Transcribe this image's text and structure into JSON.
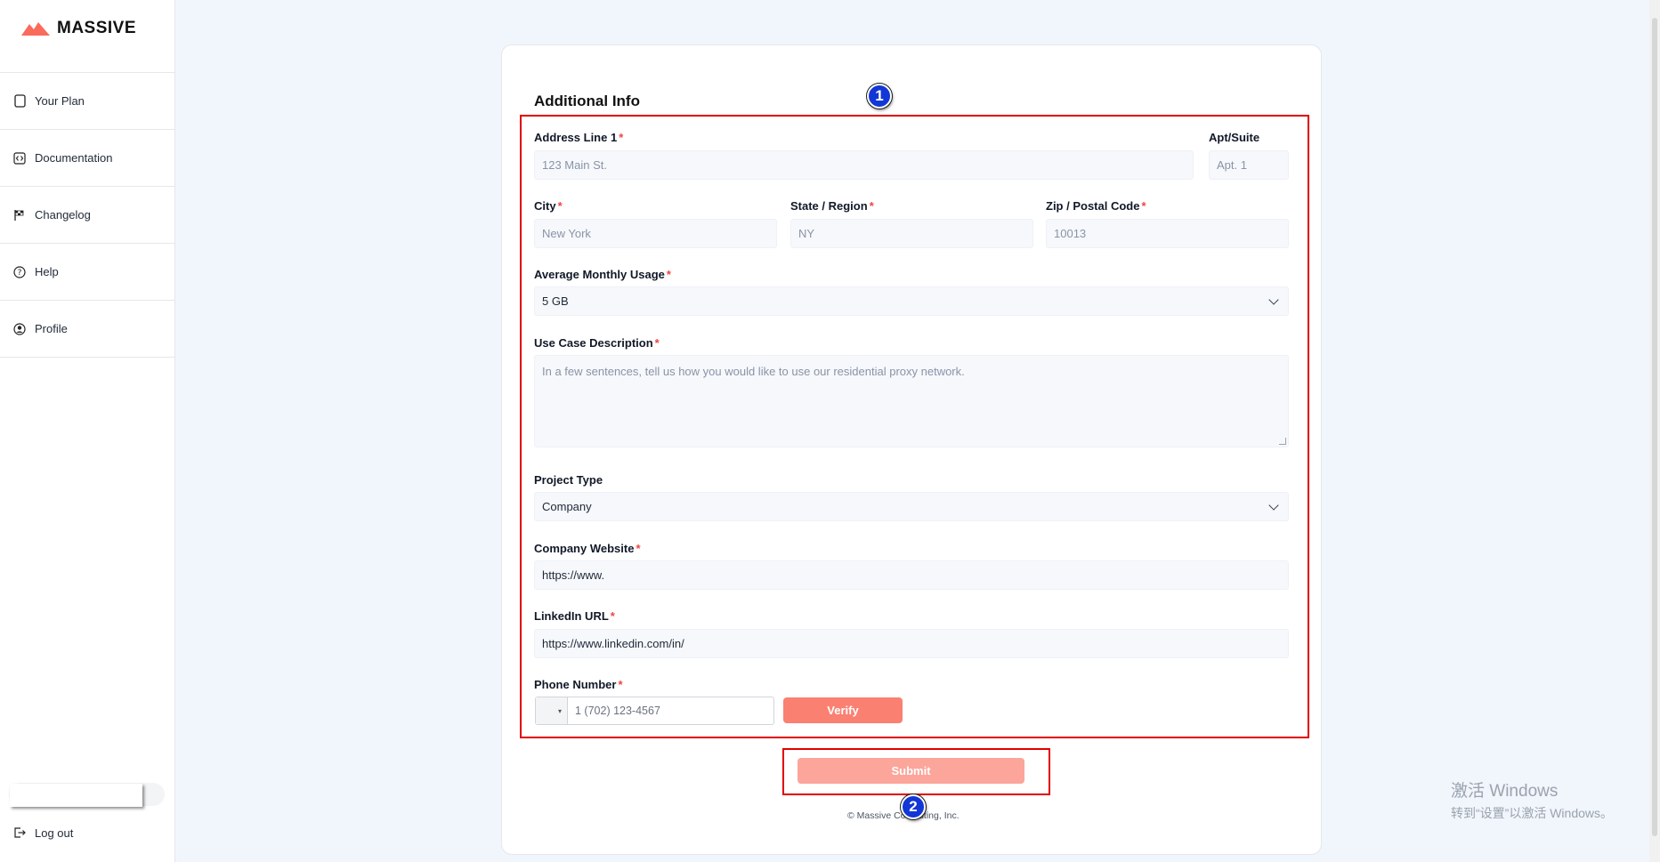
{
  "brand": {
    "name": "MASSIVE",
    "color": "#fa6b5c"
  },
  "sidebar": {
    "items": [
      {
        "label": "Your Plan",
        "icon": "document-icon"
      },
      {
        "label": "Documentation",
        "icon": "code-icon"
      },
      {
        "label": "Changelog",
        "icon": "flag-icon"
      },
      {
        "label": "Help",
        "icon": "help-icon"
      },
      {
        "label": "Profile",
        "icon": "user-circle-icon"
      }
    ],
    "logout": {
      "label": "Log out",
      "icon": "logout-icon"
    }
  },
  "form": {
    "title": "Additional Info",
    "address": {
      "label": "Address Line 1",
      "placeholder": "123 Main St."
    },
    "apt": {
      "label": "Apt/Suite",
      "placeholder": "Apt. 1"
    },
    "city": {
      "label": "City",
      "placeholder": "New York"
    },
    "state": {
      "label": "State / Region",
      "placeholder": "NY"
    },
    "zip": {
      "label": "Zip / Postal Code",
      "placeholder": "10013"
    },
    "usage": {
      "label": "Average Monthly Usage",
      "value": "5 GB"
    },
    "use_case": {
      "label": "Use Case Description",
      "placeholder": "In a few sentences, tell us how you would like to use our residential proxy network."
    },
    "project_type": {
      "label": "Project Type",
      "value": "Company"
    },
    "website": {
      "label": "Company Website",
      "value": "https://www."
    },
    "linkedin": {
      "label": "LinkedIn URL",
      "value": "https://www.linkedin.com/in/"
    },
    "phone": {
      "label": "Phone Number",
      "placeholder": "1 (702) 123-4567",
      "flag_glyph": "▾"
    },
    "required_mark": "*",
    "verify_label": "Verify",
    "submit_label": "Submit"
  },
  "footer": {
    "text": "© Massive Computing, Inc."
  },
  "annotations": {
    "badge1": "1",
    "badge2": "2",
    "color": "#e00000"
  },
  "watermark": {
    "line1": "激活 Windows",
    "line2": "转到“设置”以激活 Windows。"
  }
}
